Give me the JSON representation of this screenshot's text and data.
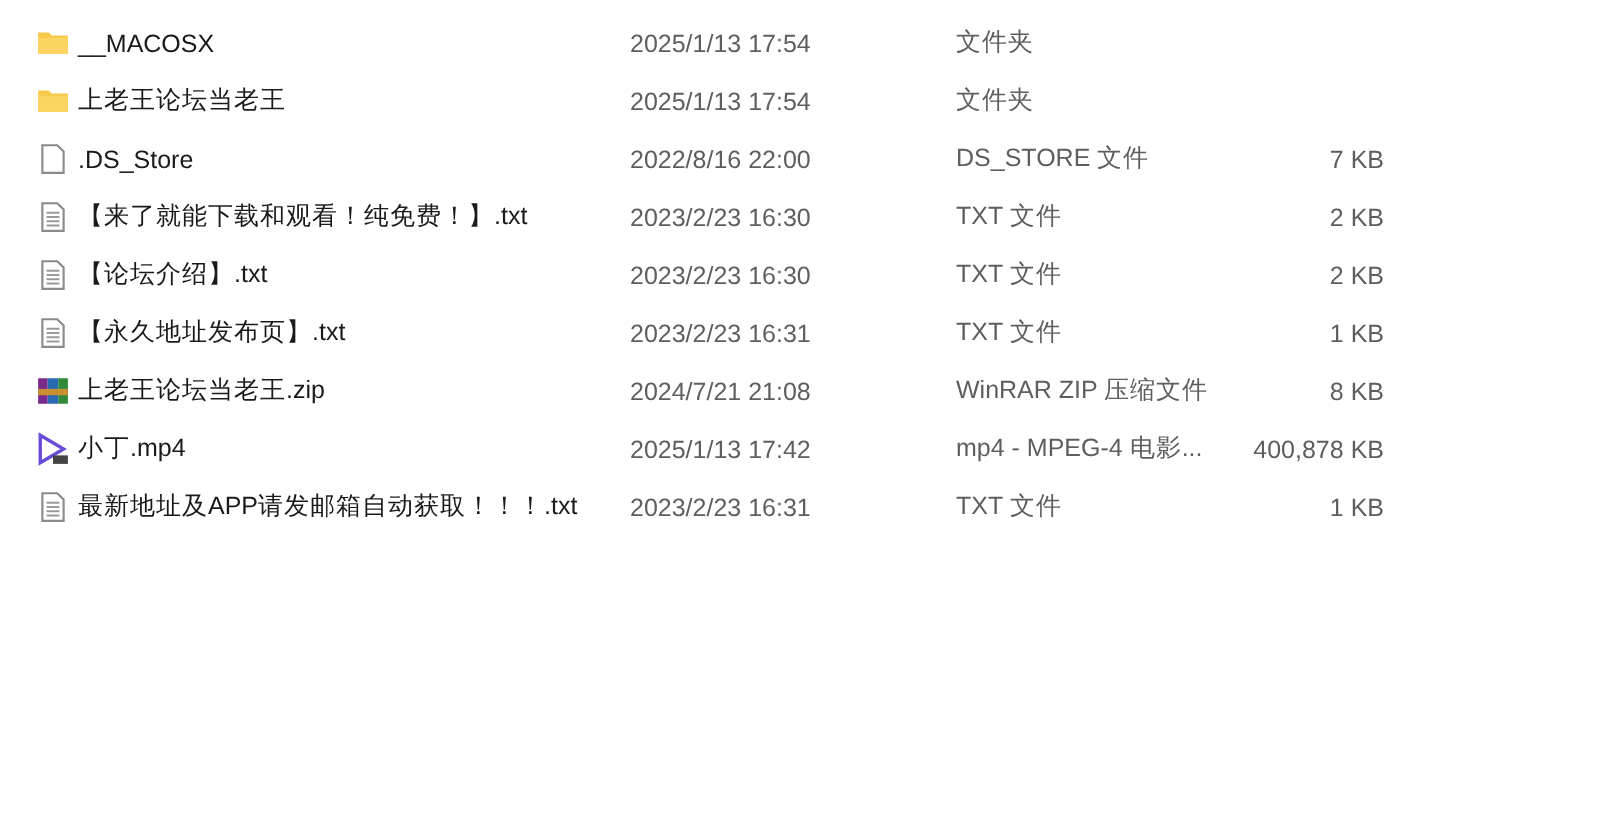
{
  "files": [
    {
      "kind": "folder",
      "name": "__MACOSX",
      "modified": "2025/1/13 17:54",
      "type": "文件夹"
    },
    {
      "kind": "folder",
      "name": "上老王论坛当老王",
      "modified": "2025/1/13 17:54",
      "type": "文件夹"
    },
    {
      "kind": "file",
      "name": ".DS_Store",
      "modified": "2022/8/16 22:00",
      "type": "DS_STORE 文件",
      "size": "7 KB"
    },
    {
      "kind": "text",
      "name": "【来了就能下载和观看！纯免费！】.txt",
      "modified": "2023/2/23 16:30",
      "type": "TXT 文件",
      "size": "2 KB"
    },
    {
      "kind": "text",
      "name": "【论坛介绍】.txt",
      "modified": "2023/2/23 16:30",
      "type": "TXT 文件",
      "size": "2 KB"
    },
    {
      "kind": "text",
      "name": "【永久地址发布页】.txt",
      "modified": "2023/2/23 16:31",
      "type": "TXT 文件",
      "size": "1 KB"
    },
    {
      "kind": "zip",
      "name": "上老王论坛当老王.zip",
      "modified": "2024/7/21 21:08",
      "type": "WinRAR ZIP 压缩文件",
      "size": "8 KB"
    },
    {
      "kind": "video",
      "name": "小丁.mp4",
      "modified": "2025/1/13 17:42",
      "type": "mp4 - MPEG-4 电影...",
      "size": "400,878 KB"
    },
    {
      "kind": "text",
      "name": "最新地址及APP请发邮箱自动获取！！！.txt",
      "modified": "2023/2/23 16:31",
      "type": "TXT 文件",
      "size": "1 KB"
    }
  ]
}
